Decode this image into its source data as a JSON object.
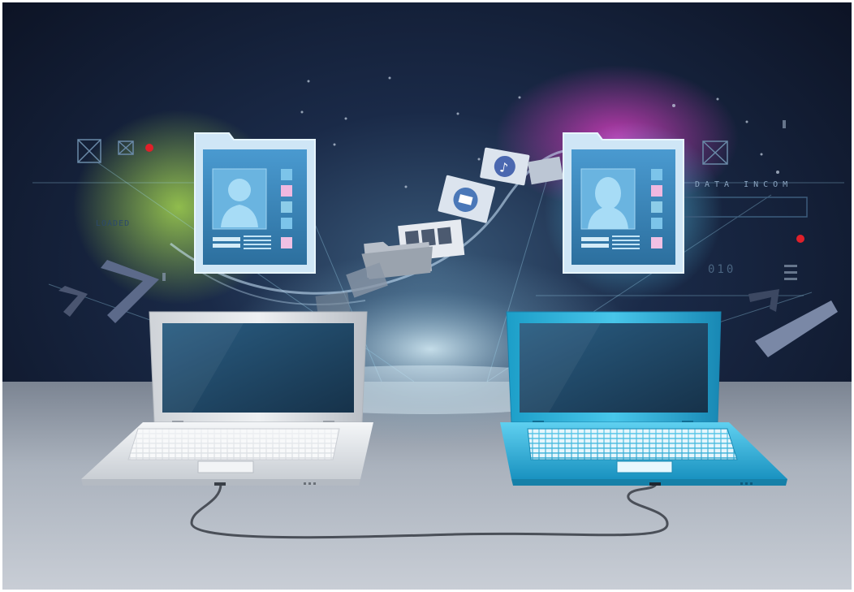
{
  "hud": {
    "left_label": "LOADED",
    "right_label": "DATA INCOM",
    "right_code": "010"
  },
  "colors": {
    "background_top": "#0b1020",
    "floor": "#8d96a2",
    "laptop_left": "#e8ebee",
    "laptop_right": "#2bb6dc",
    "screen": "#1e4a6a",
    "card_frame": "#cfe6f6",
    "card_screen": "#3a86b8",
    "glow_left": "#9fd84a",
    "glow_right": "#e04ad0",
    "indicator_red": "#e0202a"
  },
  "icons": [
    "envelope-icon",
    "music-note-icon",
    "video-icon",
    "folder-icon",
    "person-silhouette-icon",
    "chevron-right-icon"
  ]
}
